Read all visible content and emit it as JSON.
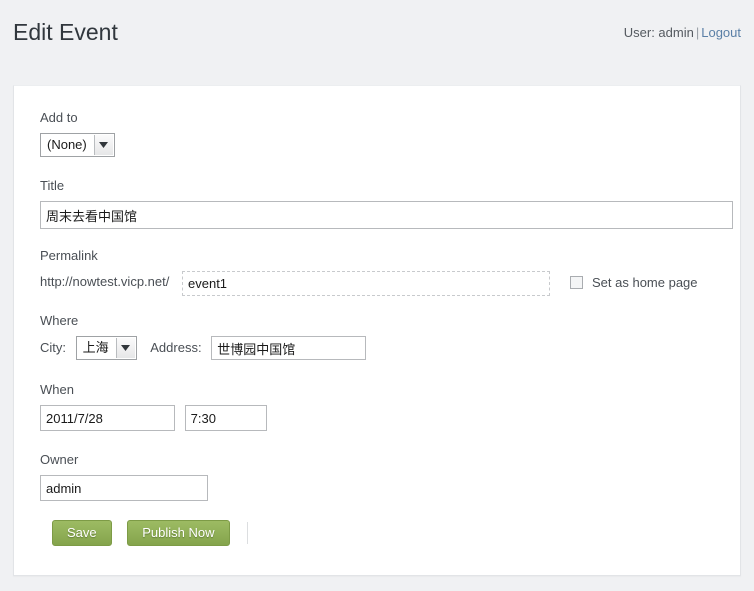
{
  "header": {
    "title": "Edit Event",
    "user_text": "User: admin",
    "separator": "|",
    "logout_label": "Logout"
  },
  "form": {
    "add_to": {
      "label": "Add to",
      "value": "(None)",
      "icon": "chevron-down-icon"
    },
    "title": {
      "label": "Title",
      "value": "周末去看中国馆",
      "placeholder": ""
    },
    "permalink": {
      "label": "Permalink",
      "base_url": "http://nowtest.vicp.net/",
      "slug_value": "event1",
      "slug_placeholder": "",
      "home_page": {
        "label": "Set as home page",
        "checked": false
      }
    },
    "where": {
      "label": "Where",
      "city_label": "City:",
      "city_value": "上海",
      "address_label": "Address:",
      "address_value": "世博园中国馆",
      "address_placeholder": ""
    },
    "when": {
      "label": "When",
      "date_value": "2011/7/28",
      "date_placeholder": "",
      "time_value": "7:30",
      "time_placeholder": ""
    },
    "owner": {
      "label": "Owner",
      "value": "admin",
      "placeholder": ""
    },
    "actions": {
      "save_label": "Save",
      "publish_label": "Publish Now"
    }
  },
  "colors": {
    "page_background": "#f0f1f3",
    "panel_background": "#ffffff",
    "button_green": "#8bab54",
    "link_blue": "#5a7fa6",
    "text": "#333333"
  }
}
